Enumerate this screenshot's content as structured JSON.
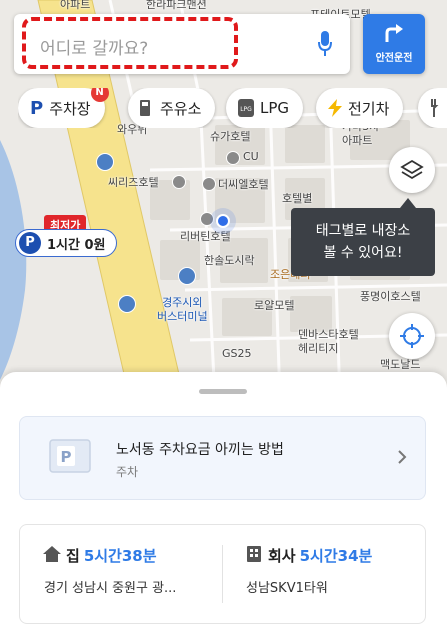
{
  "search": {
    "placeholder": "어디로 갈까요?"
  },
  "safe_drive": {
    "label": "안전운전"
  },
  "chips": [
    {
      "label": "주차장",
      "icon": "parking-icon",
      "badge": "N"
    },
    {
      "label": "주유소",
      "icon": "gas-station-icon"
    },
    {
      "label": "LPG",
      "icon": "lpg-icon"
    },
    {
      "label": "전기차",
      "icon": "ev-charging-icon"
    },
    {
      "label": "",
      "icon": "restaurant-icon"
    }
  ],
  "map_labels": {
    "top1": "아파트",
    "top2": "한라파크맨션",
    "top3": "포테이토모텔",
    "l1": "와우뷔",
    "l2": "슈가호텔",
    "l3": "CU",
    "l4": "씨리즈호텔",
    "l5": "더씨엘호텔",
    "l6": "호텔별",
    "l7": "리버틴호텔",
    "l8": "한솔도시락",
    "l9": "조은레퍼",
    "l10": "경주시외\n버스터미널",
    "l11": "로얄모텔",
    "l12": "풍명이호스텔",
    "l13": "덴바스타호텔\n헤리티지",
    "l14": "GS25",
    "l15": "맥도날드",
    "l16": "가나3차\n아파트",
    "l17": "가나3차"
  },
  "parking_marker": {
    "tag": "최저가",
    "letter": "P",
    "price": "1시간 0원"
  },
  "tooltip": {
    "line1": "태그별로 내장소",
    "line2": "볼 수 있어요!"
  },
  "tip_card": {
    "title": "노서동 주차요금 아끼는 방법",
    "subtitle": "주차"
  },
  "favorites": {
    "home": {
      "name": "집",
      "time": "5시간38분",
      "address": "경기 성남시 중원구 광..."
    },
    "work": {
      "name": "회사",
      "time": "5시간34분",
      "address": "성남SKV1타워"
    }
  },
  "colors": {
    "accent": "#2f7be6",
    "highlight": "#e0191b",
    "badge": "#e53935"
  }
}
